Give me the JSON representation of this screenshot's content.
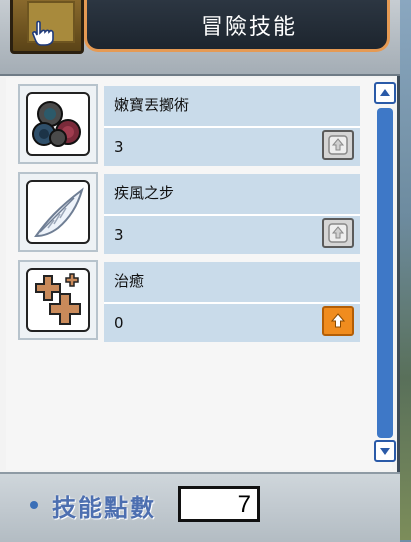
{
  "window": {
    "title": "冒險技能"
  },
  "skills": [
    {
      "name": "嫩寶丟擲術",
      "level": "3",
      "icon": "snail-shells-icon",
      "upgradable": false
    },
    {
      "name": "疾風之步",
      "level": "3",
      "icon": "wing-feather-icon",
      "upgradable": false
    },
    {
      "name": "治癒",
      "level": "0",
      "icon": "healing-crosses-icon",
      "upgradable": true
    }
  ],
  "footer": {
    "sp_label": "技能點數",
    "sp_value": "7"
  },
  "colors": {
    "title_bg": "#1d252e",
    "title_border": "#e59a54",
    "skill_row_bg": "#c9dbea",
    "upgrade_active": "#f08c1e",
    "upgrade_disabled": "#d5d5d5",
    "scroll_track": "#3e78c7",
    "sp_label": "#4d6fb0"
  }
}
